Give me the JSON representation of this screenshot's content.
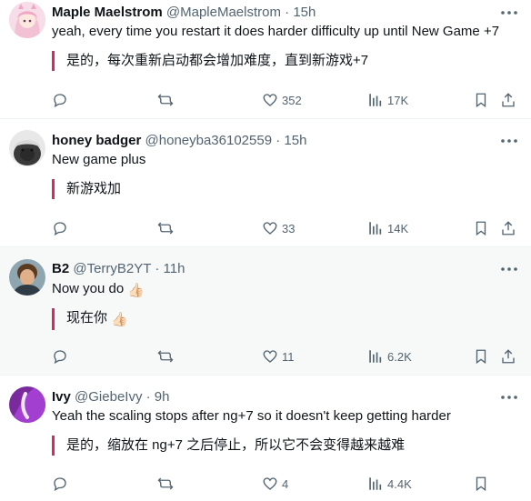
{
  "tweets": [
    {
      "name": "Maple Maelstrom",
      "handle": "@MapleMaelstrom",
      "time": "15h",
      "text": "yeah, every time you restart it does harder difficulty up until New Game +7",
      "translation": "是的，每次重新启动都会增加难度，直到新游戏+7",
      "likes": "352",
      "views": "17K",
      "avatar": "anime-girl-avatar"
    },
    {
      "name": "honey badger",
      "handle": "@honeyba36102559",
      "time": "15h",
      "text": "New game plus",
      "translation": "新游戏加",
      "likes": "33",
      "views": "14K",
      "avatar": "honey-badger-avatar"
    },
    {
      "name": "B2",
      "handle": "@TerryB2YT",
      "time": "11h",
      "text": "Now you do",
      "translation": "现在你",
      "emoji": "👍🏻",
      "likes": "11",
      "views": "6.2K",
      "avatar": "person-avatar"
    },
    {
      "name": "Ivy",
      "handle": "@GiebeIvy",
      "time": "9h",
      "text": "Yeah the scaling stops after ng+7 so it doesn't keep getting harder",
      "translation": "是的，缩放在 ng+7 之后停止，所以它不会变得越来越难",
      "likes": "4",
      "views": "4.4K",
      "avatar": "purple-abstract-avatar"
    }
  ],
  "separator": "·",
  "colors": {
    "accent_bar": "#e0245e",
    "secondary_text": "#536471",
    "hover_bg": "#f7f9f9"
  }
}
